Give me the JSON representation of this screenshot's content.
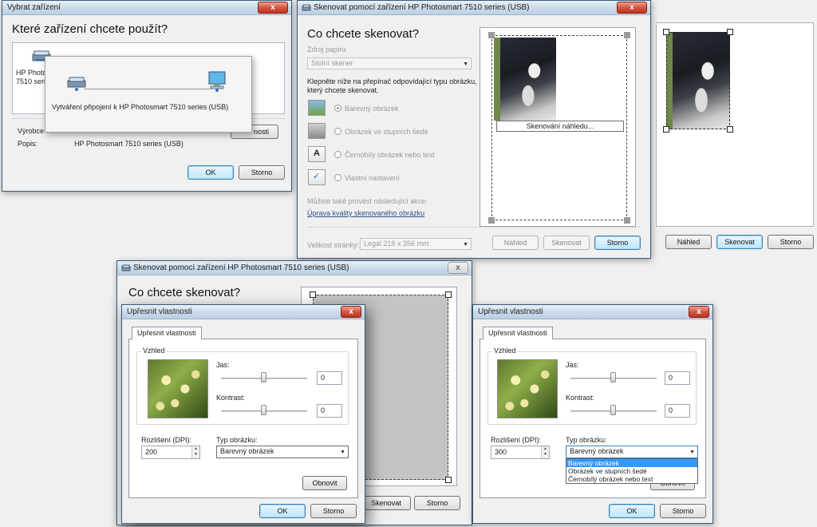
{
  "win1": {
    "title": "Vybrat zařízení",
    "heading": "Které zařízení chcete použít?",
    "device_label_line1": "HP Photo",
    "device_label_line2": "7510 serie",
    "vyrobce_label": "Výrobce",
    "popis_label": "Popis:",
    "popis_value": "HP Photosmart 7510 series (USB)",
    "vlastnosti_btn_partial": "nosti",
    "ok_label": "OK",
    "storno_label": "Storno",
    "close_glyph": "x"
  },
  "connecting_popup": {
    "message": "Vytváření připojení k HP Photosmart 7510 series (USB)"
  },
  "win2": {
    "title": "Skenovat pomocí zařízení HP Photosmart 7510 series (USB)",
    "heading": "Co chcete skenovat?",
    "source_label": "Zdroj papíru",
    "source_value": "Stolní skener",
    "instruction_line1": "Klepněte níže na přepínač odpovídající typu obrázku,",
    "instruction_line2": "který chcete skenovat.",
    "options": [
      "Barevný obrázek",
      "Obrázek ve stupních šedé",
      "Černobílý obrázek nebo text",
      "Vlastní nastavení"
    ],
    "more_actions": "Můžete také provést následující akce:",
    "adjust_link": "Úprava kvality skenovaného obrázku",
    "page_size_label": "Velikost stránky:",
    "page_size_value": "Legal 216 x 356 mm",
    "scanning_preview": "Skenování náhledu...",
    "nahled_label": "Náhled",
    "skenovat_label": "Skenovat",
    "storno_label": "Storno",
    "close_glyph": "x"
  },
  "right_panel": {
    "nahled_label": "Náhled",
    "skenovat_label": "Skenovat",
    "storno_label": "Storno"
  },
  "win3": {
    "title": "Skenovat pomocí zařízení HP Photosmart 7510 series (USB)",
    "heading": "Co chcete skenovat?",
    "skenovat_label": "Skenovat",
    "storno_label": "Storno",
    "close_glyph": "x"
  },
  "dialog_left": {
    "title": "Upřesnit vlastnosti",
    "tab_label": "Upřesnit vlastnosti",
    "group_label": "Vzhled",
    "jas_label": "Jas:",
    "jas_value": "0",
    "kontrast_label": "Kontrast:",
    "kontrast_value": "0",
    "dpi_label": "Rozlišení (DPI):",
    "dpi_value": "200",
    "type_label": "Typ obrázku:",
    "type_value": "Barevný obrázek",
    "obnovit_label": "Obnovit",
    "ok_label": "OK",
    "storno_label": "Storno",
    "close_glyph": "x"
  },
  "dialog_right": {
    "title": "Upřesnit vlastnosti",
    "tab_label": "Upřesnit vlastnosti",
    "group_label": "Vzhled",
    "jas_label": "Jas:",
    "jas_value": "0",
    "kontrast_label": "Kontrast:",
    "kontrast_value": "0",
    "dpi_label": "Rozlišení (DPI):",
    "dpi_value": "300",
    "type_label": "Typ obrázku:",
    "type_value": "Barevný obrázek",
    "type_options": [
      "Barevný obrázek",
      "Obrázek ve stupních šedé",
      "Černobílý obrázek nebo text"
    ],
    "obnovit_partial": "Obnovit",
    "ok_label": "OK",
    "storno_label": "Storno",
    "close_glyph": "x"
  },
  "icons": {
    "scanner": "scanner-icon",
    "computer": "computer-icon",
    "color_photo": "color-photo-icon",
    "grayscale_photo": "grayscale-photo-icon",
    "bw_text": "bw-text-icon",
    "custom_settings": "custom-settings-icon"
  }
}
